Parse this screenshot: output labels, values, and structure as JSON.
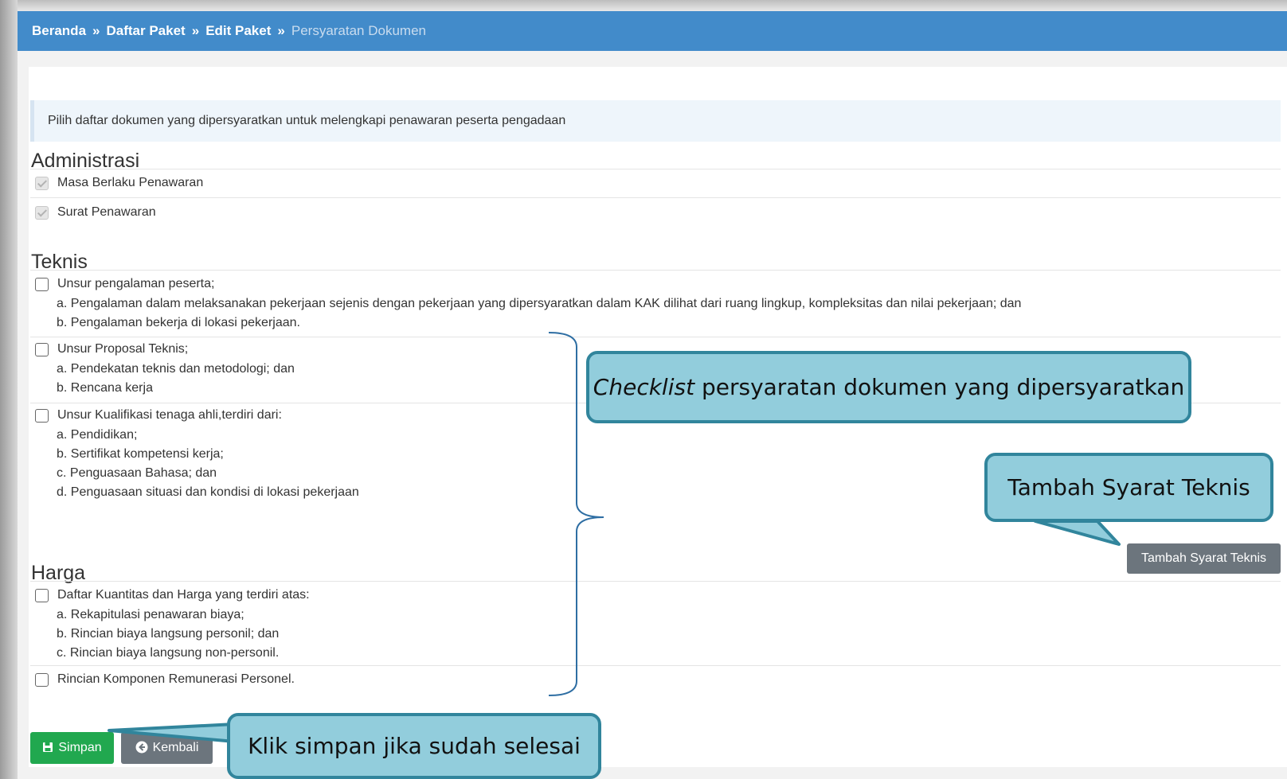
{
  "breadcrumb": {
    "items": [
      "Beranda",
      "Daftar Paket",
      "Edit Paket"
    ],
    "separator": "»",
    "active": "Persyaratan Dokumen"
  },
  "info_text": "Pilih daftar dokumen yang dipersyaratkan untuk melengkapi penawaran peserta pengadaan",
  "sections": {
    "administrasi": {
      "title": "Administrasi",
      "items": [
        {
          "label": "Masa Berlaku Penawaran",
          "checked": true,
          "disabled": true
        },
        {
          "label": "Surat Penawaran",
          "checked": true,
          "disabled": true
        }
      ]
    },
    "teknis": {
      "title": "Teknis",
      "items": [
        {
          "label": "Unsur pengalaman peserta;",
          "checked": false,
          "sub": [
            "a. Pengalaman dalam melaksanakan pekerjaan sejenis dengan pekerjaan yang dipersyaratkan dalam KAK dilihat dari ruang lingkup, kompleksitas dan nilai pekerjaan; dan",
            "b. Pengalaman bekerja di lokasi pekerjaan."
          ]
        },
        {
          "label": "Unsur Proposal Teknis;",
          "checked": false,
          "sub": [
            "a. Pendekatan teknis dan metodologi; dan",
            "b. Rencana kerja"
          ]
        },
        {
          "label": "Unsur Kualifikasi tenaga ahli,terdiri dari:",
          "checked": false,
          "sub": [
            "a. Pendidikan;",
            "b. Sertifikat kompetensi kerja;",
            "c. Penguasaan Bahasa; dan",
            "d. Penguasaan situasi dan kondisi di lokasi pekerjaan"
          ]
        }
      ],
      "add_button": "Tambah Syarat Teknis"
    },
    "harga": {
      "title": "Harga",
      "items": [
        {
          "label": "Daftar Kuantitas dan Harga yang terdiri atas:",
          "checked": false,
          "sub": [
            "a. Rekapitulasi penawaran biaya;",
            "b. Rincian biaya langsung personil; dan",
            "c. Rincian biaya langsung non-personil."
          ]
        },
        {
          "label": "Rincian Komponen Remunerasi Personel.",
          "checked": false,
          "sub": []
        }
      ]
    }
  },
  "buttons": {
    "save": "Simpan",
    "back": "Kembali",
    "save_icon": "floppy-disk-icon",
    "back_icon": "arrow-circle-left-icon"
  },
  "callouts": {
    "checklist_em": "Checklist",
    "checklist_rest": " persyaratan dokumen yang dipersyaratkan",
    "tambah": "Tambah Syarat Teknis",
    "simpan": "Klik simpan jika sudah selesai"
  },
  "colors": {
    "header_blue": "#428bca",
    "save_green": "#21a84f",
    "secondary_gray": "#6c757d",
    "callout_fill": "#92cddc",
    "callout_border": "#31859c"
  }
}
